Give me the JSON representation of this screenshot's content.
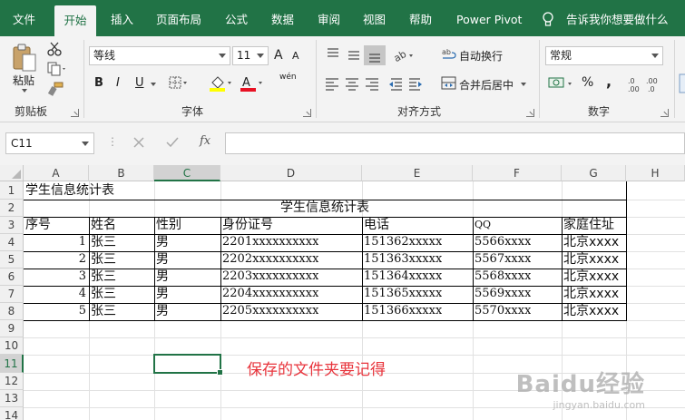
{
  "menu": {
    "tabs": [
      "文件",
      "开始",
      "插入",
      "页面布局",
      "公式",
      "数据",
      "审阅",
      "视图",
      "帮助",
      "Power Pivot"
    ],
    "active": "开始",
    "tell_me": "告诉我你想要做什么"
  },
  "ribbon": {
    "clipboard": {
      "label": "剪贴板",
      "paste": "粘贴"
    },
    "font": {
      "label": "字体",
      "name": "等线",
      "size": "11",
      "bold": "B",
      "italic": "I",
      "underline": "U",
      "grow": "A",
      "shrink": "A",
      "phonetic": "wén"
    },
    "alignment": {
      "label": "对齐方式",
      "wrap": "自动换行",
      "merge": "合并后居中"
    },
    "number": {
      "label": "数字",
      "format": "常规",
      "percent": "%",
      "comma": ","
    }
  },
  "formula_bar": {
    "name_box": "C11",
    "fx": "fx",
    "content": ""
  },
  "grid": {
    "columns": [
      "A",
      "B",
      "C",
      "D",
      "E",
      "F",
      "G",
      "H"
    ],
    "rows": [
      "1",
      "2",
      "3",
      "4",
      "5",
      "6",
      "7",
      "8",
      "9",
      "10",
      "11",
      "12",
      "13",
      "14"
    ],
    "selected_col": "C",
    "selected_row": "11",
    "a1": "学生信息统计表",
    "title": "学生信息统计表",
    "headers": [
      "序号",
      "姓名",
      "性别",
      "身份证号",
      "电话",
      "QQ",
      "家庭住址"
    ],
    "records": [
      [
        "1",
        "张三",
        "男",
        "2201xxxxxxxxxx",
        "151362xxxxx",
        "5566xxxx",
        "北京xxxx"
      ],
      [
        "2",
        "张三",
        "男",
        "2202xxxxxxxxxx",
        "151363xxxxx",
        "5567xxxx",
        "北京xxxx"
      ],
      [
        "3",
        "张三",
        "男",
        "2203xxxxxxxxxx",
        "151364xxxxx",
        "5568xxxx",
        "北京xxxx"
      ],
      [
        "4",
        "张三",
        "男",
        "2204xxxxxxxxxx",
        "151365xxxxx",
        "5569xxxx",
        "北京xxxx"
      ],
      [
        "5",
        "张三",
        "男",
        "2205xxxxxxxxxx",
        "151366xxxxx",
        "5570xxxx",
        "北京xxxx"
      ]
    ],
    "note": "保存的文件夹要记得"
  },
  "watermark": {
    "brand": "Baidu经验",
    "url": "jingyan.baidu.com"
  },
  "colors": {
    "excel_green": "#217346",
    "note_red": "#e8343c"
  }
}
